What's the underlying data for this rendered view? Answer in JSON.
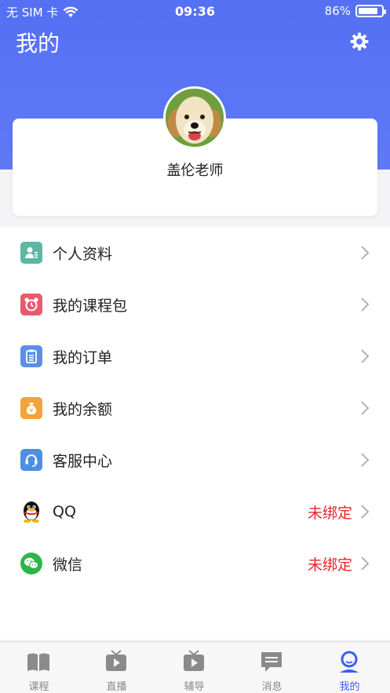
{
  "status_bar": {
    "carrier": "无 SIM 卡",
    "time": "09:36",
    "battery": "86%",
    "battery_level": 0.86
  },
  "header": {
    "title": "我的"
  },
  "profile": {
    "name": "盖伦老师"
  },
  "menu": [
    {
      "label": "个人资料",
      "status": "",
      "icon": "id-card-icon",
      "color": "#5cb8a3"
    },
    {
      "label": "我的课程包",
      "status": "",
      "icon": "alarm-clock-icon",
      "color": "#e95a6d"
    },
    {
      "label": "我的订单",
      "status": "",
      "icon": "clipboard-icon",
      "color": "#5b8fe2"
    },
    {
      "label": "我的余额",
      "status": "",
      "icon": "money-bag-icon",
      "color": "#f2a33a"
    },
    {
      "label": "客服中心",
      "status": "",
      "icon": "headset-icon",
      "color": "#4f8fe0"
    },
    {
      "label": "QQ",
      "status": "未绑定",
      "icon": "qq-penguin-icon",
      "color": "#000000"
    },
    {
      "label": "微信",
      "status": "未绑定",
      "icon": "wechat-icon",
      "color": "#2fb44a"
    }
  ],
  "colors": {
    "accent": "#5470f3",
    "unbound": "#e8262a",
    "tab_active": "#3a5ff0"
  },
  "tabbar": [
    {
      "label": "课程",
      "icon": "book-icon"
    },
    {
      "label": "直播",
      "icon": "live-tv-icon"
    },
    {
      "label": "辅导",
      "icon": "tutoring-tv-icon"
    },
    {
      "label": "消息",
      "icon": "message-icon"
    },
    {
      "label": "我的",
      "icon": "profile-icon",
      "active": true
    }
  ]
}
